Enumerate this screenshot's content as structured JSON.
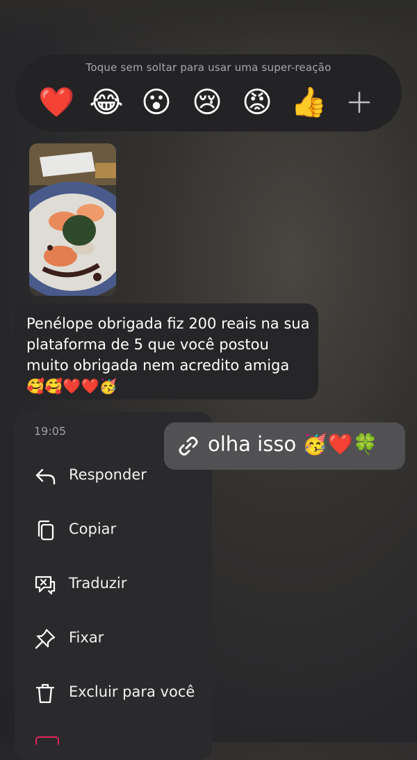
{
  "reactions": {
    "hint": "Toque sem soltar para usar uma super-reação",
    "emojis": [
      "❤️",
      "😂",
      "😮",
      "😢",
      "😡",
      "👍"
    ]
  },
  "message": {
    "text": "Penélope obrigada fiz 200 reais na sua plataforma de 5 que você postou muito obrigada nem acredito amiga 🥰🥰❤️❤️🥳"
  },
  "context_menu": {
    "time": "19:05",
    "items": [
      {
        "label": "Responder",
        "icon": "reply-icon"
      },
      {
        "label": "Copiar",
        "icon": "copy-icon"
      },
      {
        "label": "Traduzir",
        "icon": "translate-icon"
      },
      {
        "label": "Fixar",
        "icon": "pin-icon"
      },
      {
        "label": "Excluir para você",
        "icon": "trash-icon"
      }
    ]
  },
  "selected_message": {
    "text": "olha isso 🥳❤️🍀",
    "icon": "link-icon"
  }
}
